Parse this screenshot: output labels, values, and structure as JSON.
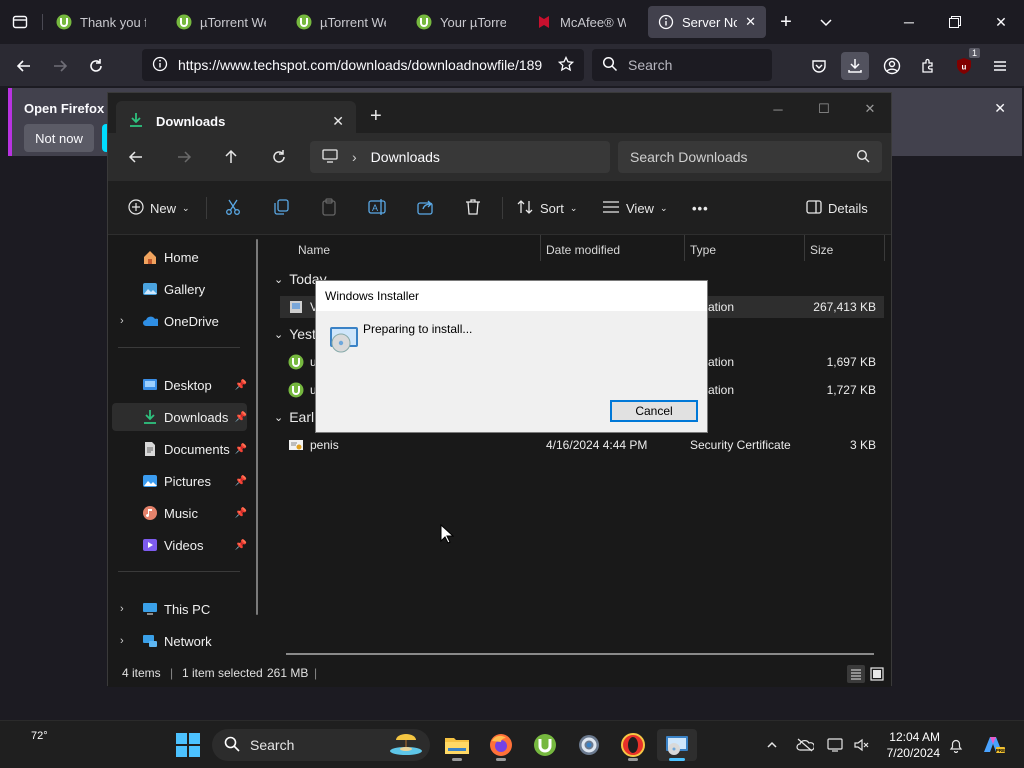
{
  "firefox": {
    "tabs": [
      {
        "title": "Thank you for",
        "icon": "utorrent-icon"
      },
      {
        "title": "µTorrent Web",
        "icon": "utorrent-icon"
      },
      {
        "title": "µTorrent Web",
        "icon": "utorrent-icon"
      },
      {
        "title": "Your µTorrent",
        "icon": "utorrent-icon"
      },
      {
        "title": "McAfee® Web",
        "icon": "mcafee-icon"
      },
      {
        "title": "Server Not F",
        "icon": "info-icon",
        "active": true
      }
    ],
    "url": "https://www.techspot.com/downloads/downloadnowfile/189",
    "search_placeholder": "Search",
    "extensions_badge": "1",
    "notification": {
      "text": "Open Firefox ev",
      "not_now": "Not now"
    },
    "accent_color": "#b833e1"
  },
  "explorer": {
    "tab_title": "Downloads",
    "breadcrumb": "Downloads",
    "search_placeholder": "Search Downloads",
    "commands": {
      "new": "New",
      "sort": "Sort",
      "view": "View",
      "details": "Details",
      "more": "•••"
    },
    "nav": {
      "home": "Home",
      "gallery": "Gallery",
      "onedrive": "OneDrive",
      "desktop": "Desktop",
      "downloads": "Downloads",
      "documents": "Documents",
      "pictures": "Pictures",
      "music": "Music",
      "videos": "Videos",
      "this_pc": "This PC",
      "network": "Network"
    },
    "columns": {
      "name": "Name",
      "date": "Date modified",
      "type": "Type",
      "size": "Size"
    },
    "groups": {
      "today": "Today",
      "yesterday": "Yest",
      "earlier": "Earl"
    },
    "rows": [
      {
        "name": "VL",
        "date": "",
        "type": "plication",
        "size": "267,413 KB"
      },
      {
        "name": "ut",
        "date": "",
        "type": "plication",
        "size": "1,697 KB"
      },
      {
        "name": "ut",
        "date": "",
        "type": "plication",
        "size": "1,727 KB"
      },
      {
        "name": "penis",
        "date": "4/16/2024 4:44 PM",
        "type": "Security Certificate",
        "size": "3 KB"
      }
    ],
    "status": {
      "items": "4 items",
      "selected": "1 item selected",
      "size": "261 MB"
    }
  },
  "installer": {
    "title": "Windows Installer",
    "message": "Preparing to install...",
    "cancel": "Cancel"
  },
  "taskbar": {
    "temperature": "72°",
    "search": "Search",
    "time": "12:04 AM",
    "date": "7/20/2024"
  }
}
